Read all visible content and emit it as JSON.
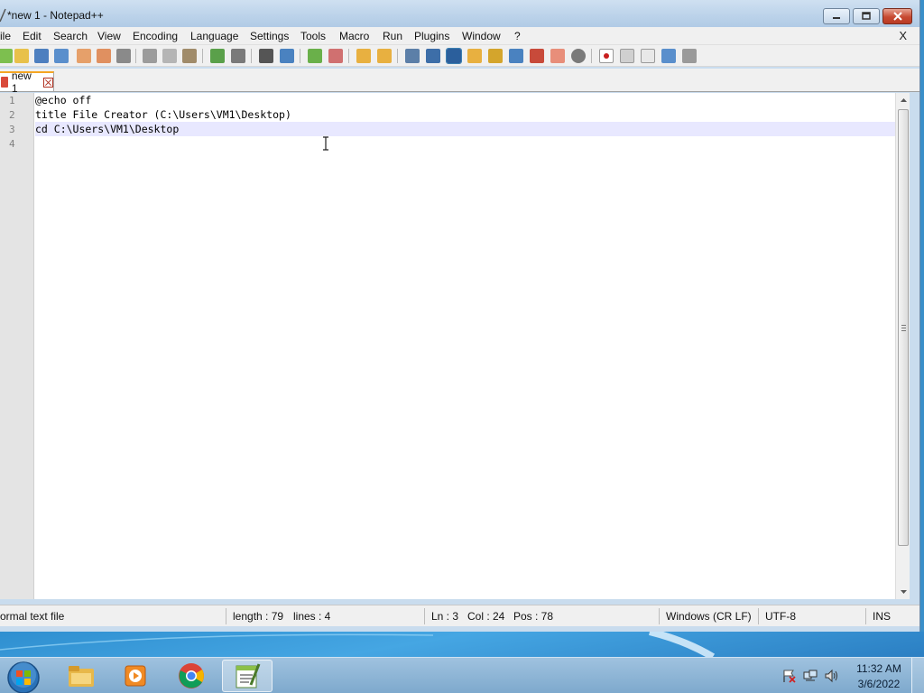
{
  "window": {
    "title": "*new 1 - Notepad++"
  },
  "menu": {
    "items": [
      "ile",
      "Edit",
      "Search",
      "View",
      "Encoding",
      "Language",
      "Settings",
      "Tools",
      "Macro",
      "Run",
      "Plugins",
      "Window",
      "?"
    ],
    "close_label": "X"
  },
  "toolbar": {
    "icons": [
      "new-file-icon",
      "open-file-icon",
      "save-icon",
      "save-all-icon",
      "close-icon",
      "close-all-icon",
      "print-icon",
      "cut-icon",
      "copy-icon",
      "paste-icon",
      "undo-icon",
      "redo-icon",
      "find-icon",
      "replace-icon",
      "zoom-in-icon",
      "zoom-out-icon",
      "sync-vertical-icon",
      "sync-horizontal-icon",
      "word-wrap-icon",
      "show-all-chars-icon",
      "indent-guide-icon",
      "user-language-icon",
      "doc-map-icon",
      "function-list-icon",
      "folder-as-workspace-icon",
      "monitoring-icon",
      "record-macro-icon",
      "stop-macro-icon",
      "play-macro-icon",
      "run-macro-multiple-icon",
      "save-macro-icon"
    ]
  },
  "tabs": [
    {
      "label": "new 1"
    }
  ],
  "editor": {
    "lines": [
      {
        "number": "1",
        "text": "@echo off"
      },
      {
        "number": "2",
        "text": "title File Creator (C:\\Users\\VM1\\Desktop)"
      },
      {
        "number": "3",
        "text": "cd C:\\Users\\VM1\\Desktop"
      },
      {
        "number": "4",
        "text": ""
      }
    ],
    "current_line": 3
  },
  "status": {
    "file_type": "ormal text file",
    "length": "length : 79",
    "lines": "lines : 4",
    "ln": "Ln : 3",
    "col": "Col : 24",
    "pos": "Pos : 78",
    "eol": "Windows (CR LF)",
    "encoding": "UTF-8",
    "mode": "INS"
  },
  "taskbar": {
    "apps": [
      "file-explorer-icon",
      "media-player-icon",
      "chrome-icon",
      "notepadpp-icon"
    ],
    "active_app": "notepadpp-icon",
    "clock_time": "11:32 AM",
    "clock_date": "3/6/2022"
  },
  "colors": {
    "current_line_bg": "#e8e8ff",
    "tab_accent": "#f5a623",
    "close_button": "#c74a32"
  }
}
